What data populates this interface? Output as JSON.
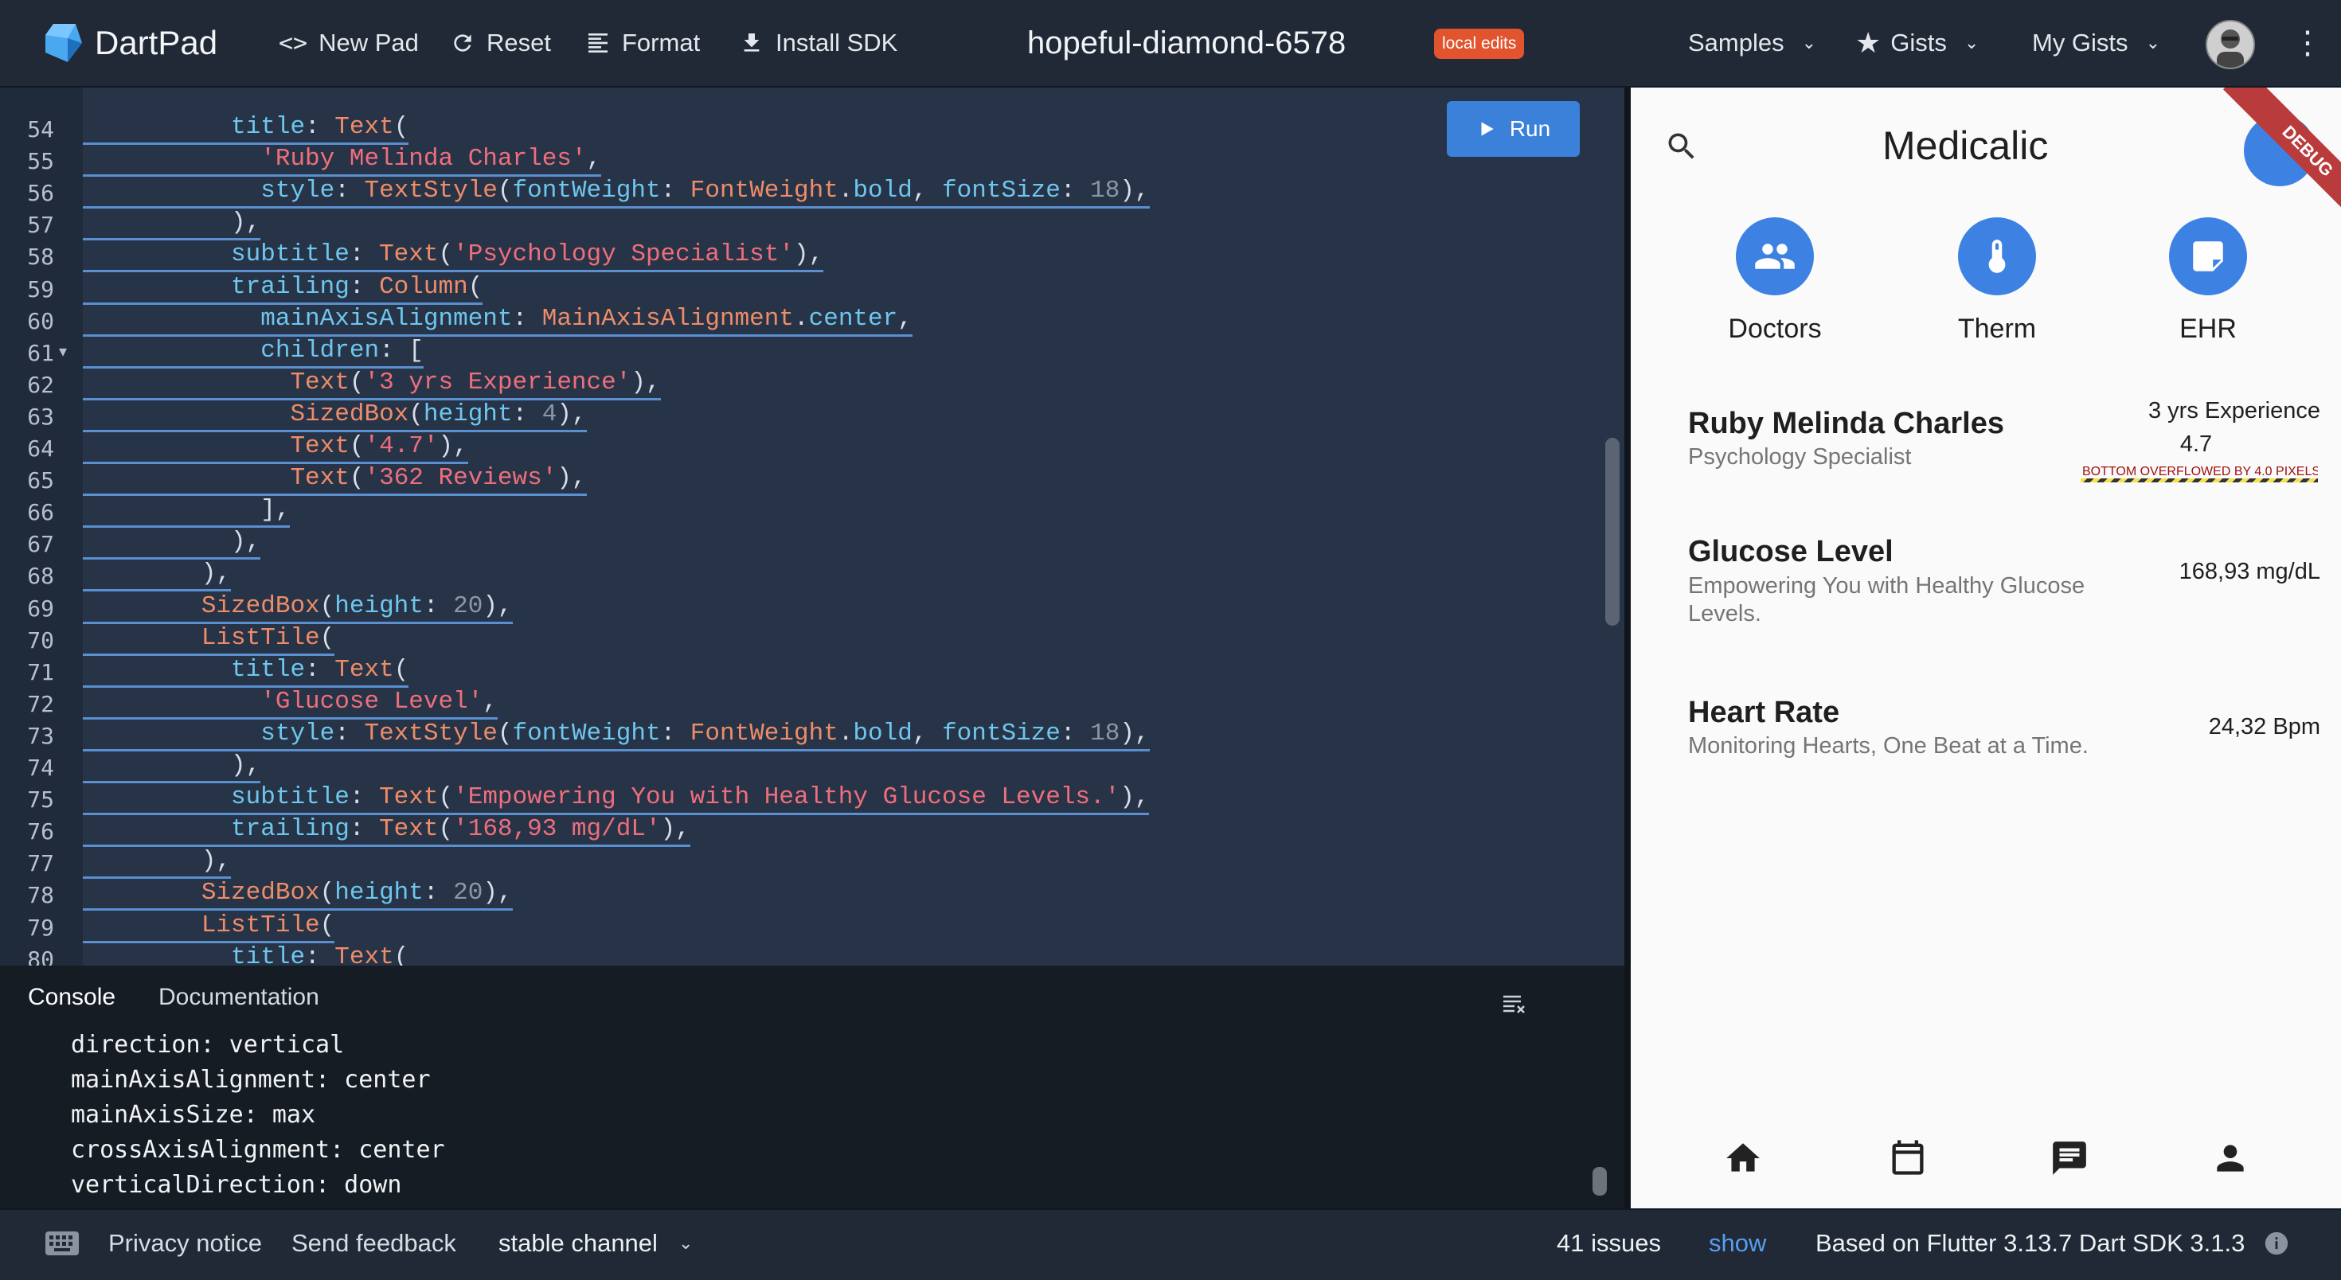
{
  "app": {
    "name": "DartPad",
    "pad_name": "hopeful-diamond-6578",
    "badge": "local edits"
  },
  "toolbar": {
    "new_pad": "New Pad",
    "reset": "Reset",
    "format": "Format",
    "install_sdk": "Install SDK"
  },
  "nav": {
    "samples": "Samples",
    "gists": "Gists",
    "my_gists": "My Gists"
  },
  "editor": {
    "run_label": "Run",
    "lines": [
      {
        "n": "54",
        "html": "          <span class='p'>title</span>: <span class='k'>Text</span>("
      },
      {
        "n": "55",
        "html": "            <span class='s'>'Ruby Melinda Charles'</span>,"
      },
      {
        "n": "56",
        "html": "            <span class='p'>style</span>: <span class='k'>TextStyle</span>(<span class='p'>fontWeight</span>: <span class='k'>FontWeight</span>.<span class='p'>bold</span>, <span class='p'>fontSize</span>: <span class='n'>18</span>),"
      },
      {
        "n": "57",
        "html": "          ),"
      },
      {
        "n": "58",
        "html": "          <span class='p'>subtitle</span>: <span class='k'>Text</span>(<span class='s'>'Psychology Specialist'</span>),"
      },
      {
        "n": "59",
        "html": "          <span class='p'>trailing</span>: <span class='k'>Column</span>("
      },
      {
        "n": "60",
        "html": "            <span class='p'>mainAxisAlignment</span>: <span class='k'>MainAxisAlignment</span>.<span class='p'>center</span>,"
      },
      {
        "n": "61",
        "html": "            <span class='p'>children</span>: ["
      },
      {
        "n": "62",
        "html": "              <span class='k'>Text</span>(<span class='s'>'3 yrs Experience'</span>),"
      },
      {
        "n": "63",
        "html": "              <span class='k'>SizedBox</span>(<span class='p'>height</span>: <span class='n'>4</span>),"
      },
      {
        "n": "64",
        "html": "              <span class='k'>Text</span>(<span class='s'>'4.7'</span>),"
      },
      {
        "n": "65",
        "html": "              <span class='k'>Text</span>(<span class='s'>'362 Reviews'</span>),"
      },
      {
        "n": "66",
        "html": "            ],"
      },
      {
        "n": "67",
        "html": "          ),"
      },
      {
        "n": "68",
        "html": "        ),"
      },
      {
        "n": "69",
        "html": "        <span class='k'>SizedBox</span>(<span class='p'>height</span>: <span class='n'>20</span>),"
      },
      {
        "n": "70",
        "html": "        <span class='k'>ListTile</span>("
      },
      {
        "n": "71",
        "html": "          <span class='p'>title</span>: <span class='k'>Text</span>("
      },
      {
        "n": "72",
        "html": "            <span class='s'>'Glucose Level'</span>,"
      },
      {
        "n": "73",
        "html": "            <span class='p'>style</span>: <span class='k'>TextStyle</span>(<span class='p'>fontWeight</span>: <span class='k'>FontWeight</span>.<span class='p'>bold</span>, <span class='p'>fontSize</span>: <span class='n'>18</span>),"
      },
      {
        "n": "74",
        "html": "          ),"
      },
      {
        "n": "75",
        "html": "          <span class='p'>subtitle</span>: <span class='k'>Text</span>(<span class='s'>'Empowering You with Healthy Glucose Levels.'</span>),"
      },
      {
        "n": "76",
        "html": "          <span class='p'>trailing</span>: <span class='k'>Text</span>(<span class='s'>'168,93 mg/dL'</span>),"
      },
      {
        "n": "77",
        "html": "        ),"
      },
      {
        "n": "78",
        "html": "        <span class='k'>SizedBox</span>(<span class='p'>height</span>: <span class='n'>20</span>),"
      },
      {
        "n": "79",
        "html": "        <span class='k'>ListTile</span>("
      },
      {
        "n": "80",
        "html": "          <span class='p'>title</span>: <span class='k'>Text</span>("
      }
    ]
  },
  "console": {
    "tab_console": "Console",
    "tab_docs": "Documentation",
    "lines": [
      "direction: vertical",
      "mainAxisAlignment: center",
      "mainAxisSize: max",
      "crossAxisAlignment: center",
      "verticalDirection: down"
    ]
  },
  "preview": {
    "app_title": "Medicalic",
    "debug": "DEBUG",
    "categories": [
      "Doctors",
      "Therm",
      "EHR"
    ],
    "tiles": [
      {
        "title": "Ruby Melinda Charles",
        "subtitle": "Psychology Specialist",
        "trailing": [
          "3 yrs Experience",
          "4.7"
        ],
        "overflow": "BOTTOM OVERFLOWED BY 4.0 PIXELS"
      },
      {
        "title": "Glucose Level",
        "subtitle": "Empowering You with Healthy Glucose Levels.",
        "trailing": [
          "168,93 mg/dL"
        ]
      },
      {
        "title": "Heart Rate",
        "subtitle": "Monitoring Hearts, One Beat at a Time.",
        "trailing": [
          "24,32 Bpm"
        ]
      }
    ]
  },
  "status": {
    "privacy": "Privacy notice",
    "feedback": "Send feedback",
    "channel": "stable channel",
    "issues": "41 issues",
    "show": "show",
    "version": "Based on Flutter 3.13.7 Dart SDK 3.1.3"
  }
}
